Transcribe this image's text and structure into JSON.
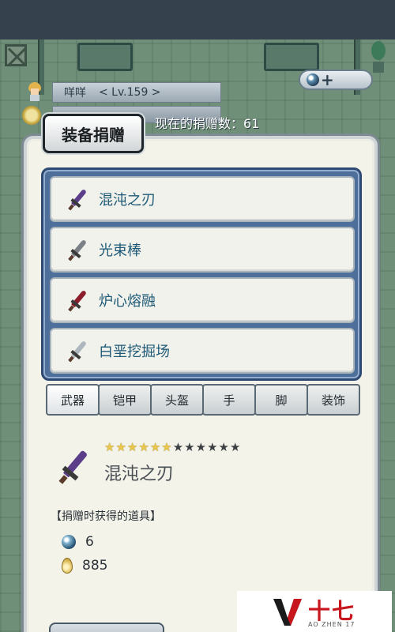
{
  "player": {
    "name": "咩咩",
    "level": "< Lv.159 >"
  },
  "donation_count_text": "现在的捐赠数：61",
  "panel_title": "装备捐赠",
  "weapons": [
    {
      "name": "混沌之刃",
      "color": "#5b3d8a"
    },
    {
      "name": "光束棒",
      "color": "#7b8187"
    },
    {
      "name": "炉心熔融",
      "color": "#8b1e2a"
    },
    {
      "name": "白垩挖掘场",
      "color": "#aeb7bd"
    }
  ],
  "categories": [
    "武器",
    "铠甲",
    "头盔",
    "手",
    "脚",
    "装饰"
  ],
  "selected_item": {
    "name": "混沌之刃",
    "rarity_stars": 6,
    "rarity_max": 12
  },
  "rewards_heading": "【捐赠时获得的道具】",
  "rewards": [
    {
      "icon": "orb-icon",
      "amount": "6"
    },
    {
      "icon": "drop-icon",
      "amount": "885"
    }
  ],
  "watermark": {
    "text": "十七",
    "sub": "AO ZHEN 17"
  }
}
